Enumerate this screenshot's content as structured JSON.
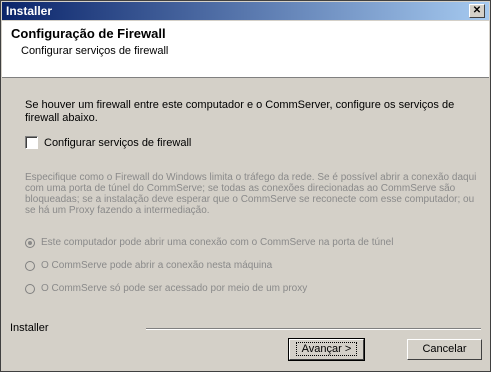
{
  "window": {
    "title": "Installer",
    "close_icon": "✕"
  },
  "header": {
    "title": "Configuração de Firewall",
    "subtitle": "Configurar serviços de firewall"
  },
  "main": {
    "intro": "Se houver um firewall entre este computador e o CommServer, configure os serviços de firewall abaixo.",
    "checkbox_label": "Configurar serviços de firewall",
    "checkbox_checked": false,
    "description": "Especifique como o Firewall do Windows limita o tráfego da rede. Se é possível abrir a conexão daqui com uma porta de túnel do CommServe; se todas as conexões direcionadas ao CommServe são bloqueadas; se a instalação deve esperar que o CommServe se reconecte com esse computador; ou se há um Proxy fazendo a intermediação.",
    "options": [
      {
        "label": "Este computador pode abrir uma conexão com o CommServe na porta de túnel",
        "checked": true
      },
      {
        "label": "O CommServe pode abrir a conexão nesta máquina",
        "checked": false
      },
      {
        "label": "O CommServe só pode ser acessado por meio de um proxy",
        "checked": false
      }
    ]
  },
  "footer": {
    "label": "Installer",
    "next_button": "Avançar >",
    "cancel_button": "Cancelar"
  }
}
